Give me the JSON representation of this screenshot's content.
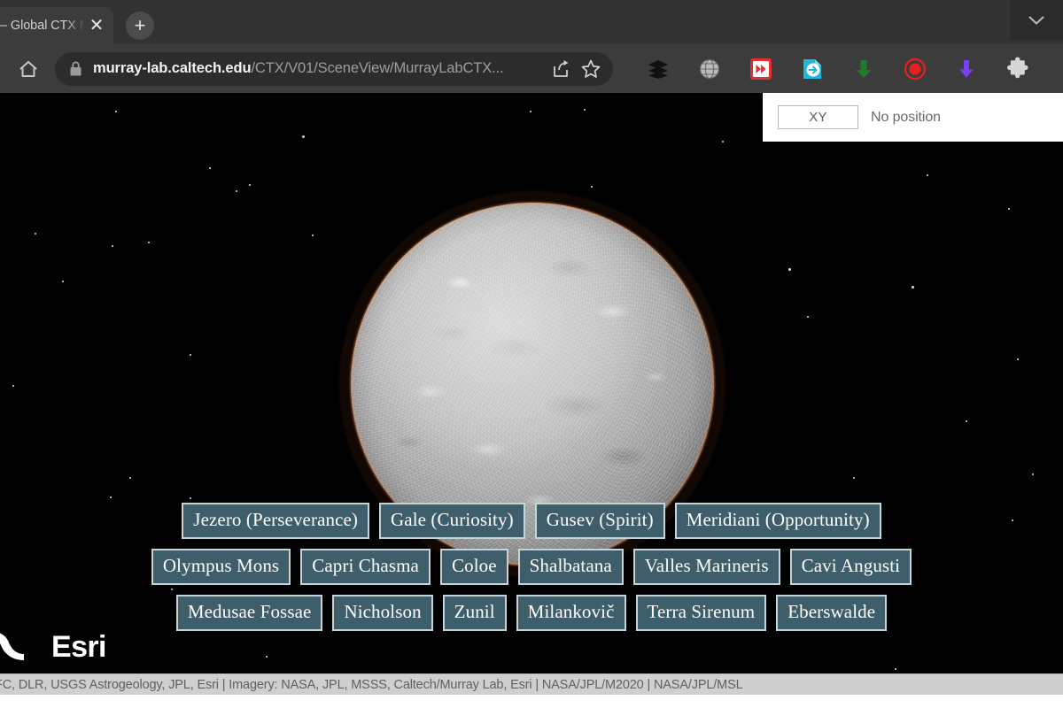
{
  "browser": {
    "tab": {
      "title": "– Global CTX M",
      "close_label": "✕",
      "newtab_label": "+"
    },
    "tab_search_name": "chevron-down-icon",
    "omnibox": {
      "host": "murray-lab.caltech.edu",
      "path": "/CTX/V01/SceneView/MurrayLabCTX...",
      "lock_icon": "lock-icon",
      "share_icon": "share-icon",
      "bookmark_icon": "star-icon"
    },
    "home_icon": "home-icon",
    "extensions": [
      {
        "name": "layers-icon",
        "color": "#1a1a1a"
      },
      {
        "name": "globe-icon",
        "color": "#b9b9b9"
      },
      {
        "name": "fast-forward-icon",
        "color": "#e03131"
      },
      {
        "name": "page-export-icon",
        "color": "#1fb6e0"
      },
      {
        "name": "green-download-arrow-icon",
        "color": "#1f7a2e"
      },
      {
        "name": "record-circle-icon",
        "color": "#ea2020"
      },
      {
        "name": "purple-download-arrow-icon",
        "color": "#7b3ff2"
      },
      {
        "name": "puzzle-piece-icon",
        "color": "#d9d9d9"
      }
    ]
  },
  "scene": {
    "position_widget": {
      "mode_button": "XY",
      "status": "No position"
    },
    "globe": {
      "name": "mars-globe",
      "glow_color": "#ff8034",
      "surface_color": "#c8c8c8"
    },
    "bookmarks": {
      "accent_bg": "#3f5e6c",
      "border_color": "#c9d3d6",
      "rows": [
        [
          "Jezero (Perseverance)",
          "Gale (Curiosity)",
          "Gusev (Spirit)",
          "Meridiani (Opportunity)"
        ],
        [
          "Olympus Mons",
          "Capri Chasma",
          "Coloe",
          "Shalbatana",
          "Valles Marineris",
          "Cavi Angusti"
        ],
        [
          "Medusae Fossae",
          "Nicholson",
          "Zunil",
          "Milankovič",
          "Terra Sirenum",
          "Eberswalde"
        ]
      ]
    },
    "esri_logo": {
      "word": "Esri",
      "mark_name": "esri-globe-mark"
    },
    "attribution": "FC, DLR, USGS Astrogeology, JPL, Esri | Imagery: NASA, JPL, MSSS, Caltech/Murray Lab, Esri | NASA/JPL/M2020 | NASA/JPL/MSL"
  }
}
